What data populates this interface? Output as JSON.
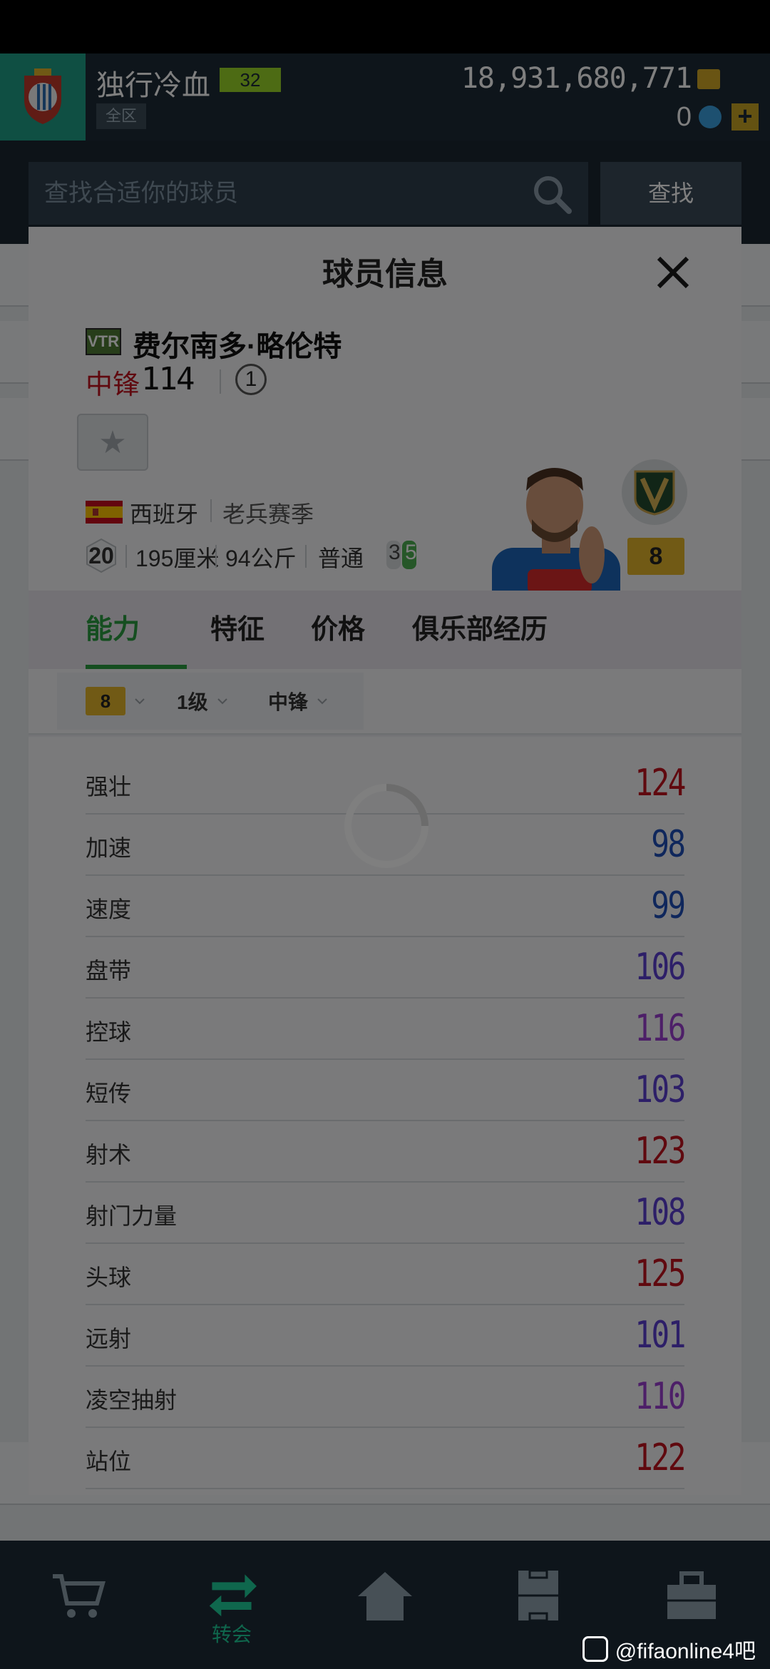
{
  "header": {
    "username": "独行冷血",
    "level": "32",
    "rank_tag": "全区",
    "coins": "18,931,680,771",
    "points": "0"
  },
  "search": {
    "placeholder": "查找合适你的球员",
    "button_label": "查找"
  },
  "bottom_nav": {
    "transfer_label": "转会"
  },
  "modal": {
    "title": "球员信息",
    "player": {
      "season_code": "VTR",
      "name": "费尔南多·略伦特",
      "position": "中锋",
      "ovr": "114",
      "enhance_level": "1",
      "nation": "西班牙",
      "season_name": "老兵赛季",
      "age": "20",
      "height": "195厘米",
      "weight": "94公斤",
      "body_type": "普通",
      "skill_left": "3",
      "skill_right": "5",
      "grade": "8"
    },
    "tabs": [
      "能力",
      "特征",
      "价格",
      "俱乐部经历"
    ],
    "filters": {
      "grade": "8",
      "level": "1级",
      "position": "中锋"
    },
    "stats": [
      {
        "name": "强壮",
        "value": "124",
        "color": "#c1121f"
      },
      {
        "name": "加速",
        "value": "98",
        "color": "#1f4fb8"
      },
      {
        "name": "速度",
        "value": "99",
        "color": "#1f4fb8"
      },
      {
        "name": "盘带",
        "value": "106",
        "color": "#5b3fd0"
      },
      {
        "name": "控球",
        "value": "116",
        "color": "#9b3fd0"
      },
      {
        "name": "短传",
        "value": "103",
        "color": "#5b3fd0"
      },
      {
        "name": "射术",
        "value": "123",
        "color": "#c1121f"
      },
      {
        "name": "射门力量",
        "value": "108",
        "color": "#5b3fd0"
      },
      {
        "name": "头球",
        "value": "125",
        "color": "#c1121f"
      },
      {
        "name": "远射",
        "value": "101",
        "color": "#5b3fd0"
      },
      {
        "name": "凌空抽射",
        "value": "110",
        "color": "#9b3fd0"
      },
      {
        "name": "站位",
        "value": "122",
        "color": "#c1121f"
      }
    ]
  },
  "watermark": "@fifaonline4吧"
}
